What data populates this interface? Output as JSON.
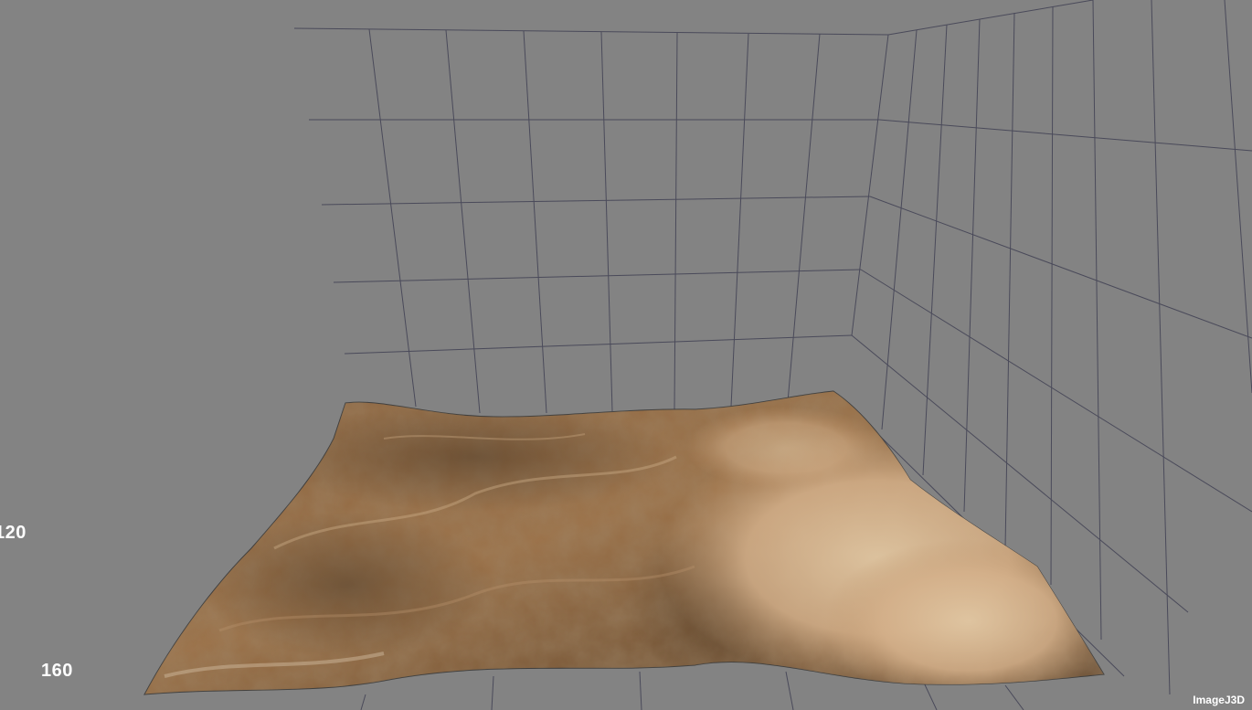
{
  "viewer": {
    "axis_labels": [
      "120",
      "160"
    ],
    "watermark": "ImageJ3D"
  },
  "colors": {
    "background": "#838383",
    "grid_lines": "#4a4a5a",
    "terrain_base": "#9a6f45",
    "terrain_highlight": "#cfb99a",
    "terrain_shadow": "#5a4128",
    "label_text": "#ffffff"
  }
}
